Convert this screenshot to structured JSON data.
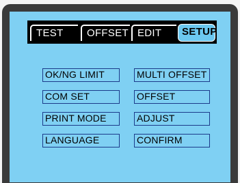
{
  "tabs": [
    {
      "label": "TEST",
      "active": false
    },
    {
      "label": "OFFSET",
      "active": false
    },
    {
      "label": "EDIT",
      "active": false
    },
    {
      "label": "SETUP",
      "active": true
    }
  ],
  "menu": {
    "left": [
      "OK/NG LIMIT",
      "COM SET",
      "PRINT MODE",
      "LANGUAGE"
    ],
    "right": [
      "MULTI OFFSET",
      "OFFSET",
      "ADJUST",
      "CONFIRM"
    ]
  },
  "colors": {
    "screen_bg": "#7fd0f3",
    "tab_bar": "#000000",
    "button_border": "#1b3a8a",
    "active_tab_bg": "#6cc8f0"
  }
}
